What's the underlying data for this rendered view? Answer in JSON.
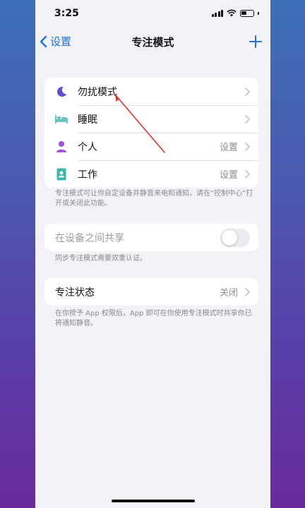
{
  "status_bar": {
    "time": "3:25"
  },
  "nav": {
    "back_label": "设置",
    "title": "专注模式"
  },
  "focus_modes": [
    {
      "label": "勿扰模式",
      "value": "",
      "icon": "moon-icon",
      "color": "#5a4fcf"
    },
    {
      "label": "睡眠",
      "value": "",
      "icon": "bed-icon",
      "color": "#63c7c0"
    },
    {
      "label": "个人",
      "value": "设置",
      "icon": "person-icon",
      "color": "#a252d6"
    },
    {
      "label": "工作",
      "value": "设置",
      "icon": "id-badge-icon",
      "color": "#3bb7b0"
    }
  ],
  "focus_modes_footnote": "专注模式可让你自定设备并静音来电和通知。请在“控制中心”打开或关闭此功能。",
  "share": {
    "label": "在设备之间共享",
    "enabled": false,
    "footnote": "同步专注模式需要双重认证。"
  },
  "focus_status": {
    "label": "专注状态",
    "value": "关闭",
    "footnote": "在你授予 App 权限后，App 即可在你使用专注模式时共享你已将通知静音。"
  },
  "colors": {
    "accent": "#1a73e8",
    "annotation_arrow": "#d9332b"
  }
}
